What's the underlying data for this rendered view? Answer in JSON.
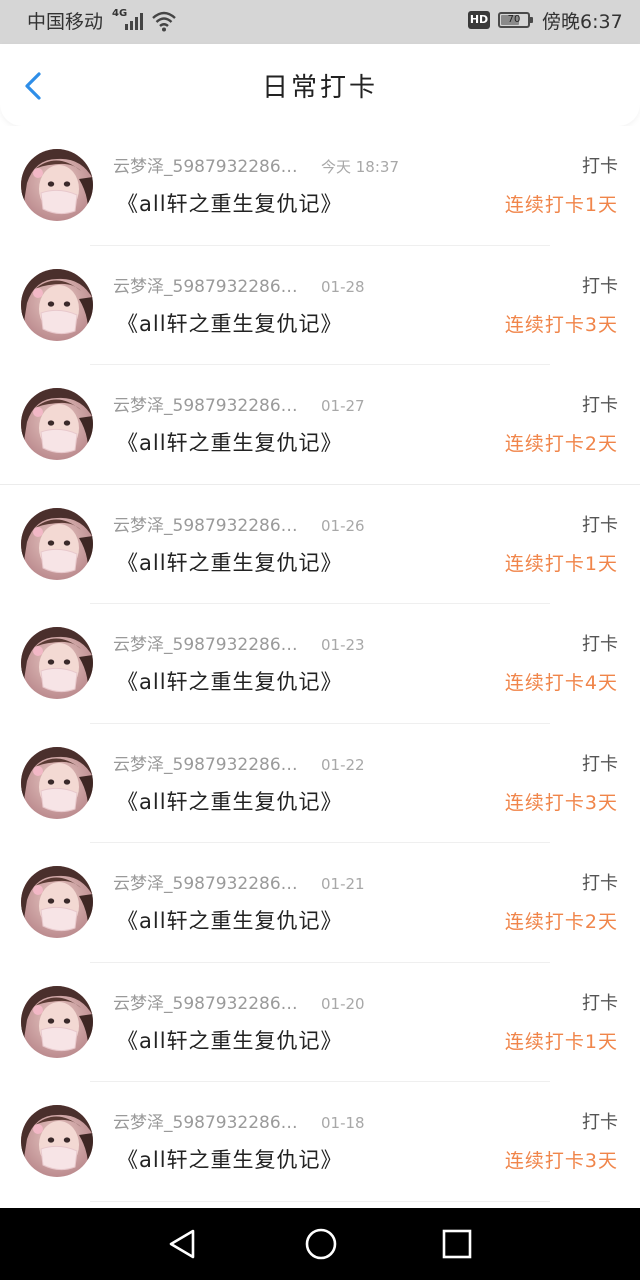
{
  "status_bar": {
    "carrier": "中国移动",
    "network": "4G",
    "battery": "70",
    "battery_level": 0.7,
    "time": "傍晚6:37",
    "hd": "HD"
  },
  "header": {
    "title": "日常打卡"
  },
  "list": {
    "items": [
      {
        "username": "云梦泽_5987932286…",
        "date": "今天  18:37",
        "book": "《all轩之重生复仇记》",
        "action": "打卡",
        "streak": "连续打卡1天"
      },
      {
        "username": "云梦泽_5987932286…",
        "date": "01-28",
        "book": "《all轩之重生复仇记》",
        "action": "打卡",
        "streak": "连续打卡3天"
      },
      {
        "username": "云梦泽_5987932286…",
        "date": "01-27",
        "book": "《all轩之重生复仇记》",
        "action": "打卡",
        "streak": "连续打卡2天"
      },
      {
        "username": "云梦泽_5987932286…",
        "date": "01-26",
        "book": "《all轩之重生复仇记》",
        "action": "打卡",
        "streak": "连续打卡1天"
      },
      {
        "username": "云梦泽_5987932286…",
        "date": "01-23",
        "book": "《all轩之重生复仇记》",
        "action": "打卡",
        "streak": "连续打卡4天"
      },
      {
        "username": "云梦泽_5987932286…",
        "date": "01-22",
        "book": "《all轩之重生复仇记》",
        "action": "打卡",
        "streak": "连续打卡3天"
      },
      {
        "username": "云梦泽_5987932286…",
        "date": "01-21",
        "book": "《all轩之重生复仇记》",
        "action": "打卡",
        "streak": "连续打卡2天"
      },
      {
        "username": "云梦泽_5987932286…",
        "date": "01-20",
        "book": "《all轩之重生复仇记》",
        "action": "打卡",
        "streak": "连续打卡1天"
      },
      {
        "username": "云梦泽_5987932286…",
        "date": "01-18",
        "book": "《all轩之重生复仇记》",
        "action": "打卡",
        "streak": "连续打卡3天"
      }
    ]
  },
  "colors": {
    "accent_back": "#2e8ee8",
    "streak": "#f0854a",
    "status_bg": "#d6d6d6"
  },
  "icons": {
    "back": "chevron-left-icon",
    "nav_back": "triangle-back-icon",
    "nav_home": "circle-home-icon",
    "nav_recent": "square-recent-icon"
  }
}
